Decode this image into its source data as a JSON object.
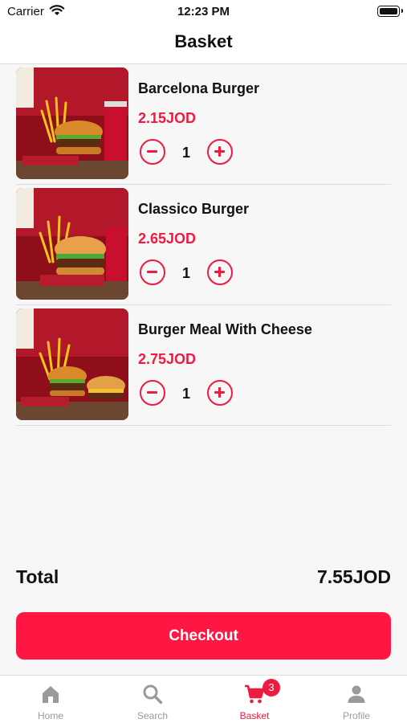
{
  "status_bar": {
    "carrier": "Carrier",
    "time": "12:23 PM"
  },
  "nav": {
    "title": "Basket"
  },
  "items": [
    {
      "name": "Barcelona Burger",
      "price": "2.15JOD",
      "quantity": "1"
    },
    {
      "name": "Classico Burger",
      "price": "2.65JOD",
      "quantity": "1"
    },
    {
      "name": "Burger Meal With Cheese",
      "price": "2.75JOD",
      "quantity": "1"
    }
  ],
  "summary": {
    "total_label": "Total",
    "total_value": "7.55JOD"
  },
  "checkout": {
    "label": "Checkout"
  },
  "tabs": [
    {
      "label": "Home",
      "icon": "home-icon"
    },
    {
      "label": "Search",
      "icon": "search-icon"
    },
    {
      "label": "Basket",
      "icon": "cart-icon",
      "badge": "3",
      "active": true
    },
    {
      "label": "Profile",
      "icon": "person-icon"
    }
  ],
  "colors": {
    "accent": "#f0193f",
    "checkout": "#ff1744",
    "inactive": "#9a9a9a",
    "image_background": "#8e0f1a"
  }
}
